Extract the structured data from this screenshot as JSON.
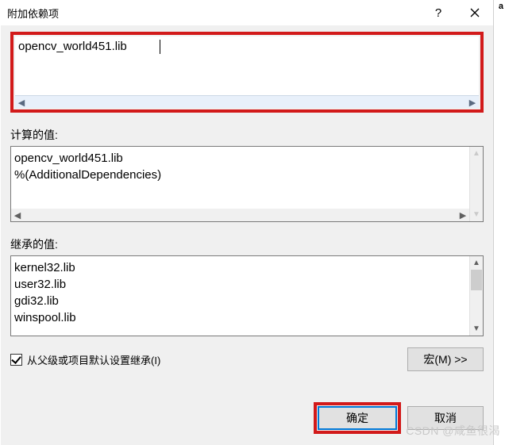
{
  "title": "附加依赖项",
  "titlebar": {
    "help_symbol": "?",
    "close_label": "Close"
  },
  "edit": {
    "value": "opencv_world451.lib"
  },
  "computed": {
    "label": "计算的值:",
    "lines": [
      "opencv_world451.lib",
      "%(AdditionalDependencies)"
    ]
  },
  "inherited": {
    "label": "继承的值:",
    "lines": [
      "kernel32.lib",
      "user32.lib",
      "gdi32.lib",
      "winspool.lib"
    ]
  },
  "inherit_checkbox": {
    "checked": true,
    "label": "从父级或项目默认设置继承(I)"
  },
  "buttons": {
    "macro": "宏(M) >>",
    "ok": "确定",
    "cancel": "取消"
  },
  "watermark": "CSDN @咸鱼很渴",
  "side_mark": "a"
}
